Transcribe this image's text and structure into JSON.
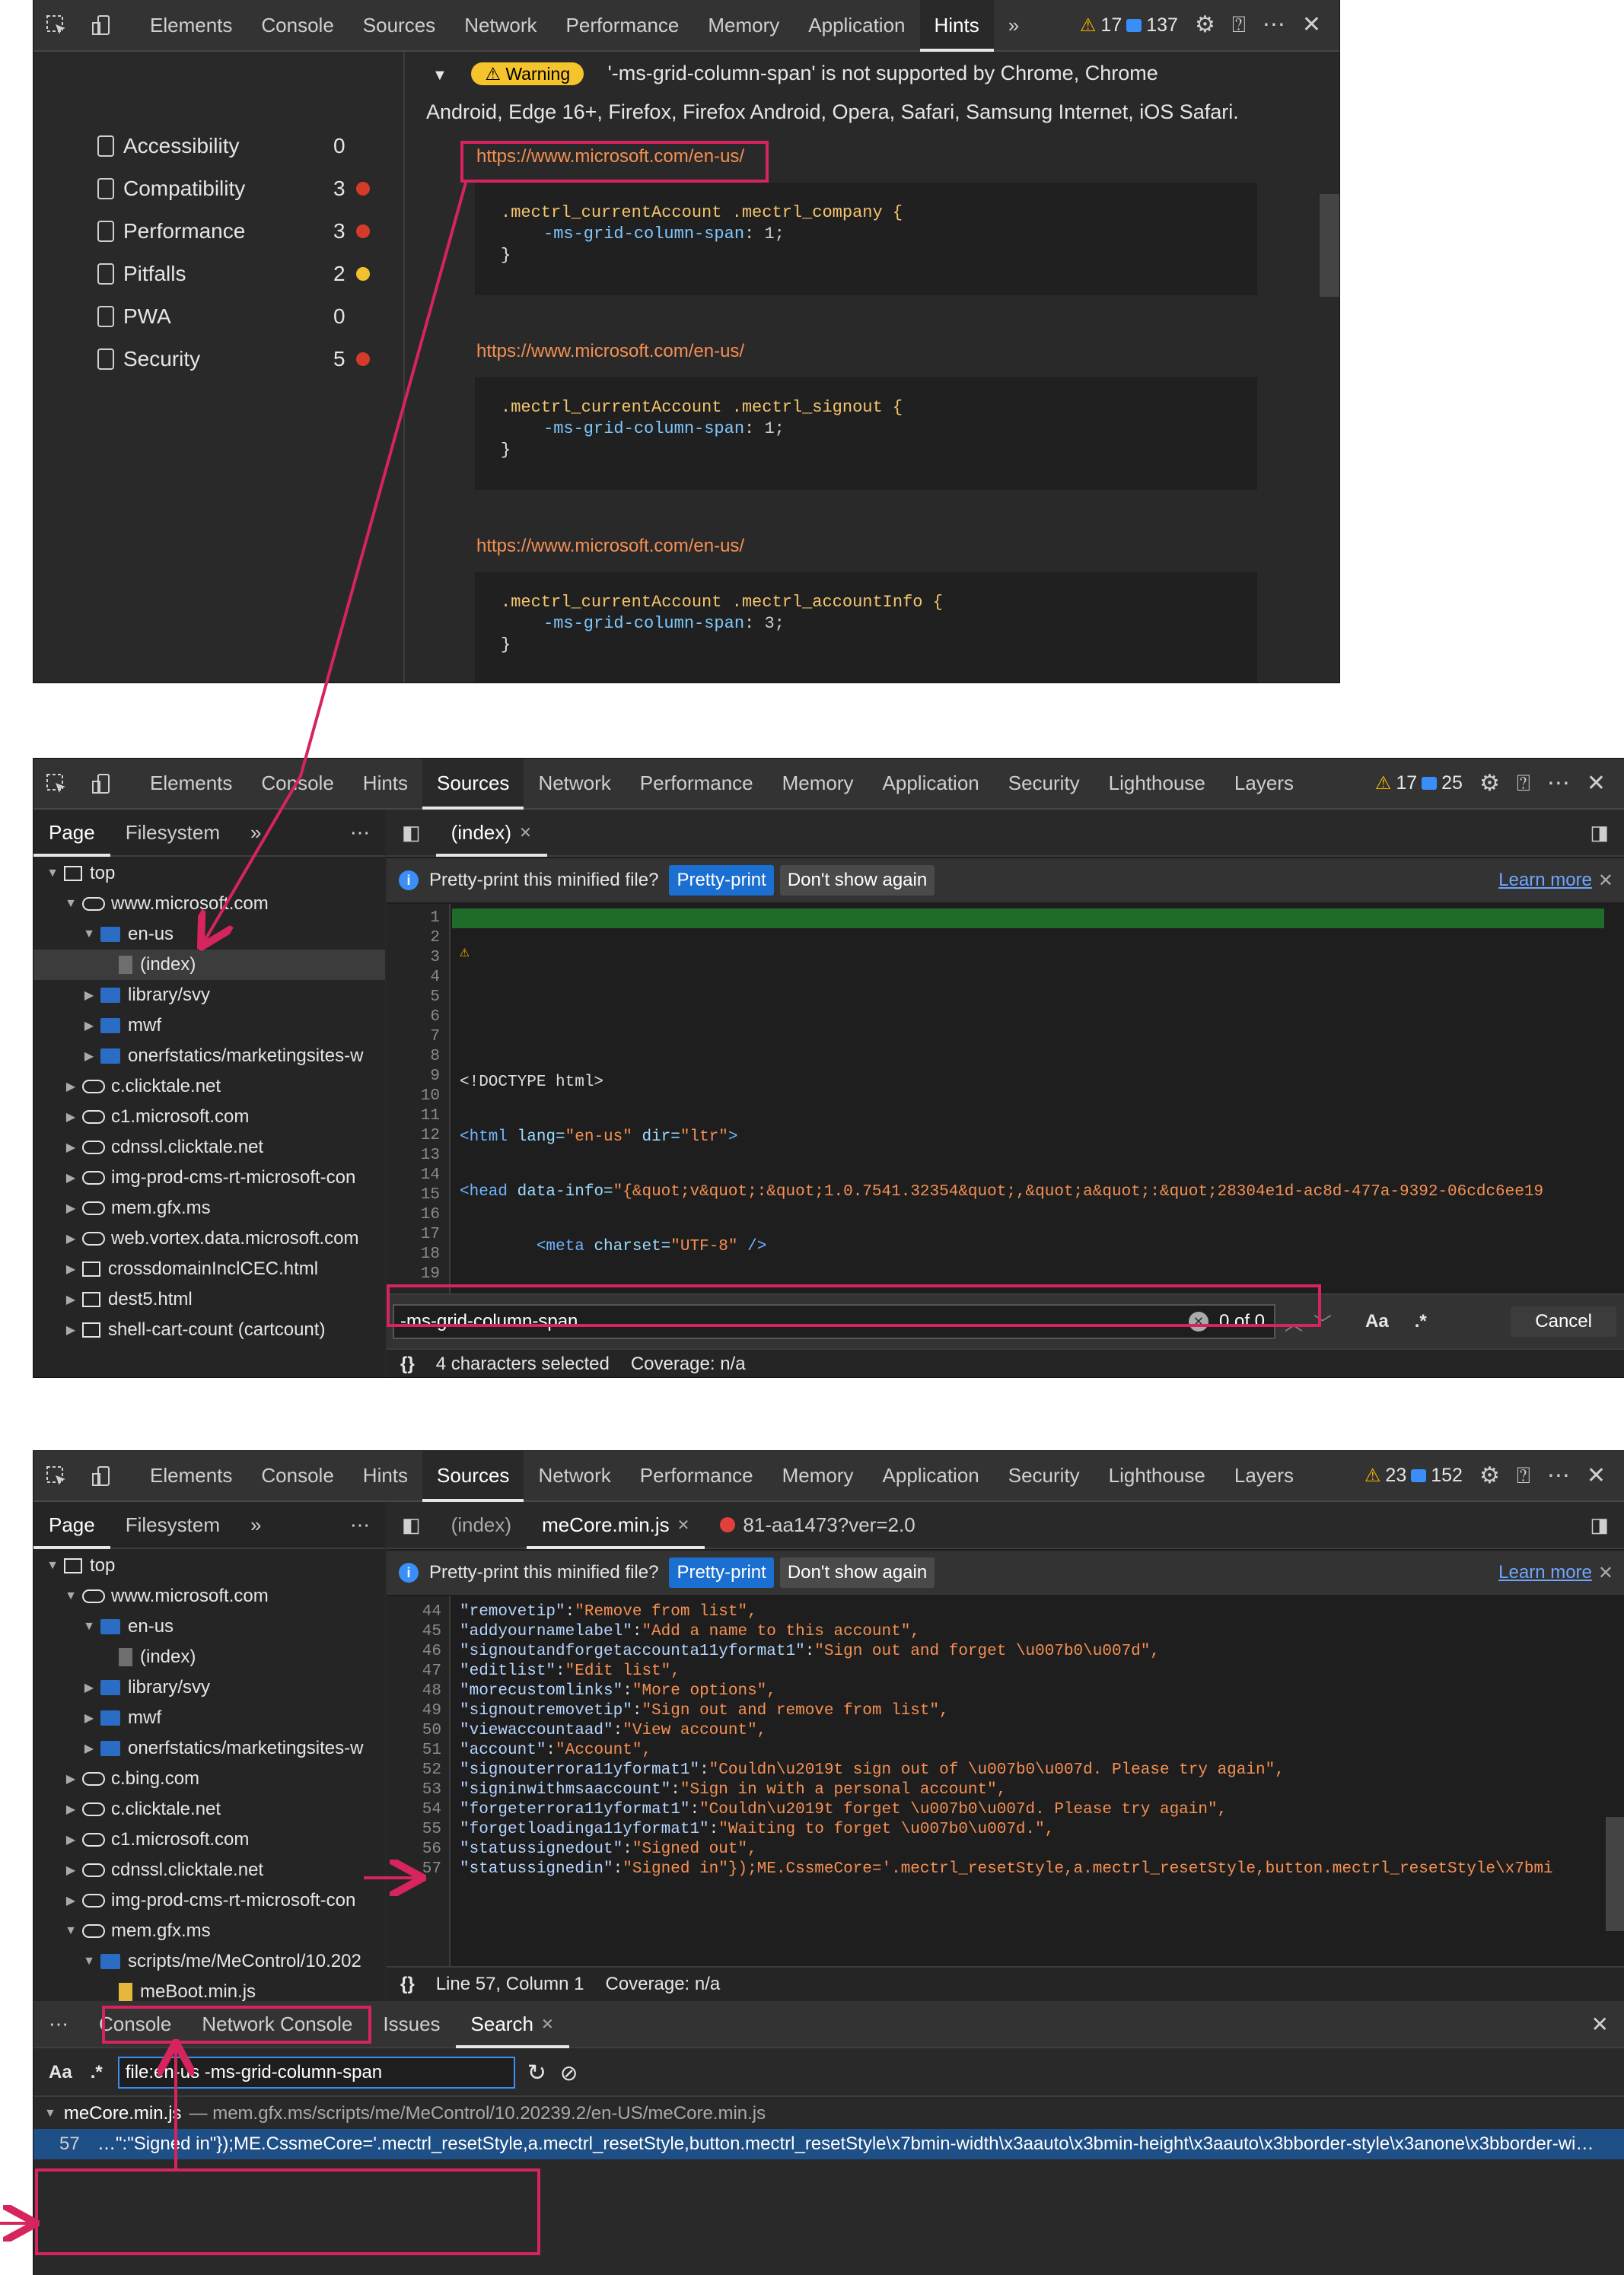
{
  "panel1": {
    "tabs": [
      "Elements",
      "Console",
      "Sources",
      "Network",
      "Performance",
      "Memory",
      "Application",
      "Hints"
    ],
    "active_tab": "Hints",
    "more": "»",
    "warnings": "17",
    "messages": "137",
    "categories": [
      {
        "name": "Accessibility",
        "count": "0",
        "dot": ""
      },
      {
        "name": "Compatibility",
        "count": "3",
        "dot": "#d63b2a"
      },
      {
        "name": "Performance",
        "count": "3",
        "dot": "#d63b2a"
      },
      {
        "name": "Pitfalls",
        "count": "2",
        "dot": "#f2c12e"
      },
      {
        "name": "PWA",
        "count": "0",
        "dot": ""
      },
      {
        "name": "Security",
        "count": "5",
        "dot": "#d63b2a"
      }
    ],
    "warning_label": "Warning",
    "warning_text_1": "'-ms-grid-column-span' is not supported by Chrome, Chrome",
    "warning_text_2": "Android, Edge 16+, Firefox, Firefox Android, Opera, Safari, Samsung Internet, iOS Safari.",
    "hints": [
      {
        "url": "https://www.microsoft.com/en-us/",
        "selector": ".mectrl_currentAccount .mectrl_company {",
        "property": "-ms-grid-column-span",
        "value": "1;"
      },
      {
        "url": "https://www.microsoft.com/en-us/",
        "selector": ".mectrl_currentAccount .mectrl_signout {",
        "property": "-ms-grid-column-span",
        "value": "1;"
      },
      {
        "url": "https://www.microsoft.com/en-us/",
        "selector": ".mectrl_currentAccount .mectrl_accountInfo {",
        "property": "-ms-grid-column-span",
        "value": "3;"
      }
    ]
  },
  "panel2": {
    "tabs": [
      "Elements",
      "Console",
      "Hints",
      "Sources",
      "Network",
      "Performance",
      "Memory",
      "Application",
      "Security",
      "Lighthouse",
      "Layers"
    ],
    "active_tab": "Sources",
    "warnings": "17",
    "messages": "25",
    "nav_tabs": [
      "Page",
      "Filesystem"
    ],
    "file_tab": "(index)",
    "tree": [
      {
        "label": "top",
        "type": "frame",
        "indent": 0,
        "arrow": "▼"
      },
      {
        "label": "www.microsoft.com",
        "type": "cloud",
        "indent": 1,
        "arrow": "▼"
      },
      {
        "label": "en-us",
        "type": "folder",
        "indent": 2,
        "arrow": "▼"
      },
      {
        "label": "(index)",
        "type": "file",
        "indent": 3,
        "arrow": "",
        "selected": true
      },
      {
        "label": "library/svy",
        "type": "folder",
        "indent": 2,
        "arrow": "▶"
      },
      {
        "label": "mwf",
        "type": "folder",
        "indent": 2,
        "arrow": "▶"
      },
      {
        "label": "onerfstatics/marketingsites-w",
        "type": "folder",
        "indent": 2,
        "arrow": "▶"
      },
      {
        "label": "c.clicktale.net",
        "type": "cloud",
        "indent": 1,
        "arrow": "▶"
      },
      {
        "label": "c1.microsoft.com",
        "type": "cloud",
        "indent": 1,
        "arrow": "▶"
      },
      {
        "label": "cdnssl.clicktale.net",
        "type": "cloud",
        "indent": 1,
        "arrow": "▶"
      },
      {
        "label": "img-prod-cms-rt-microsoft-con",
        "type": "cloud",
        "indent": 1,
        "arrow": "▶"
      },
      {
        "label": "mem.gfx.ms",
        "type": "cloud",
        "indent": 1,
        "arrow": "▶"
      },
      {
        "label": "web.vortex.data.microsoft.com",
        "type": "cloud",
        "indent": 1,
        "arrow": "▶"
      },
      {
        "label": "crossdomainInclCEC.html",
        "type": "frame",
        "indent": 1,
        "arrow": "▶"
      },
      {
        "label": "dest5.html",
        "type": "frame",
        "indent": 1,
        "arrow": "▶"
      },
      {
        "label": "shell-cart-count (cartcount)",
        "type": "frame",
        "indent": 1,
        "arrow": "▶"
      }
    ],
    "info_text": "Pretty-print this minified file?",
    "pretty_print": "Pretty-print",
    "dont_show": "Don't show again",
    "learn_more": "Learn more",
    "line_numbers": [
      "1",
      "2",
      "3",
      "4",
      "5",
      "6",
      "7",
      "8",
      "9",
      "10",
      "11",
      "12",
      "13",
      "14",
      "15",
      "16",
      "17",
      "18",
      "19"
    ],
    "search_value": "-ms-grid-column-span",
    "search_count": "0 of 0",
    "match_case": "Aa",
    "regex": ".*",
    "cancel": "Cancel",
    "status_braces": "{}",
    "status_selected": "4 characters selected",
    "status_coverage": "Coverage: n/a"
  },
  "panel3": {
    "tabs": [
      "Elements",
      "Console",
      "Hints",
      "Sources",
      "Network",
      "Performance",
      "Memory",
      "Application",
      "Security",
      "Lighthouse",
      "Layers"
    ],
    "active_tab": "Sources",
    "warnings": "23",
    "messages": "152",
    "nav_tabs": [
      "Page",
      "Filesystem"
    ],
    "file_tabs": [
      "(index)",
      "meCore.min.js",
      "81-aa1473?ver=2.0"
    ],
    "tree": [
      {
        "label": "top",
        "type": "frame",
        "indent": 0,
        "arrow": "▼"
      },
      {
        "label": "www.microsoft.com",
        "type": "cloud",
        "indent": 1,
        "arrow": "▼"
      },
      {
        "label": "en-us",
        "type": "folder",
        "indent": 2,
        "arrow": "▼"
      },
      {
        "label": "(index)",
        "type": "file",
        "indent": 3,
        "arrow": ""
      },
      {
        "label": "library/svy",
        "type": "folder",
        "indent": 2,
        "arrow": "▶"
      },
      {
        "label": "mwf",
        "type": "folder",
        "indent": 2,
        "arrow": "▶"
      },
      {
        "label": "onerfstatics/marketingsites-w",
        "type": "folder",
        "indent": 2,
        "arrow": "▶"
      },
      {
        "label": "c.bing.com",
        "type": "cloud",
        "indent": 1,
        "arrow": "▶"
      },
      {
        "label": "c.clicktale.net",
        "type": "cloud",
        "indent": 1,
        "arrow": "▶"
      },
      {
        "label": "c1.microsoft.com",
        "type": "cloud",
        "indent": 1,
        "arrow": "▶"
      },
      {
        "label": "cdnssl.clicktale.net",
        "type": "cloud",
        "indent": 1,
        "arrow": "▶"
      },
      {
        "label": "img-prod-cms-rt-microsoft-con",
        "type": "cloud",
        "indent": 1,
        "arrow": "▶"
      },
      {
        "label": "mem.gfx.ms",
        "type": "cloud",
        "indent": 1,
        "arrow": "▼"
      },
      {
        "label": "scripts/me/MeControl/10.202",
        "type": "folder",
        "indent": 2,
        "arrow": "▼"
      },
      {
        "label": "meBoot.min.js",
        "type": "jsfile",
        "indent": 3,
        "arrow": ""
      },
      {
        "label": "meCore.min.js",
        "type": "jsfile",
        "indent": 3,
        "arrow": "",
        "selected": true
      }
    ],
    "info_text": "Pretty-print this minified file?",
    "pretty_print": "Pretty-print",
    "dont_show": "Don't show again",
    "learn_more": "Learn more",
    "code_lines": [
      {
        "n": "44",
        "k": "\"removetip\"",
        "v": "\"Remove from list\","
      },
      {
        "n": "45",
        "k": "\"addyournamelabel\"",
        "v": "\"Add a name to this account\","
      },
      {
        "n": "46",
        "k": "\"signoutandforgetaccounta11yformat1\"",
        "v": "\"Sign out and forget \\u007b0\\u007d\","
      },
      {
        "n": "47",
        "k": "\"editlist\"",
        "v": "\"Edit list\","
      },
      {
        "n": "48",
        "k": "\"morecustomlinks\"",
        "v": "\"More options\","
      },
      {
        "n": "49",
        "k": "\"signoutremovetip\"",
        "v": "\"Sign out and remove from list\","
      },
      {
        "n": "50",
        "k": "\"viewaccountaad\"",
        "v": "\"View account\","
      },
      {
        "n": "51",
        "k": "\"account\"",
        "v": "\"Account\","
      },
      {
        "n": "52",
        "k": "\"signouterrora11yformat1\"",
        "v": "\"Couldn\\u2019t sign out of \\u007b0\\u007d. Please try again\","
      },
      {
        "n": "53",
        "k": "\"signinwithmsaaccount\"",
        "v": "\"Sign in with a personal account\","
      },
      {
        "n": "54",
        "k": "\"forgeterrora11yformat1\"",
        "v": "\"Couldn\\u2019t forget \\u007b0\\u007d. Please try again\","
      },
      {
        "n": "55",
        "k": "\"forgetloadinga11yformat1\"",
        "v": "\"Waiting to forget \\u007b0\\u007d.\","
      },
      {
        "n": "56",
        "k": "\"statussignedout\"",
        "v": "\"Signed out\","
      },
      {
        "n": "57",
        "k": "\"statussignedin\"",
        "v": "\"Signed in\"});ME.CssmeCore='.mectrl_resetStyle,a.mectrl_resetStyle,button.mectrl_resetStyle\\x7bmi"
      }
    ],
    "status_braces": "{}",
    "status_position": "Line 57, Column 1",
    "status_coverage": "Coverage: n/a",
    "drawer_tabs": [
      "Console",
      "Network Console",
      "Issues",
      "Search"
    ],
    "drawer_active": "Search",
    "search_query": "file:en-us -ms-grid-column-span",
    "match_case": "Aa",
    "regex": ".*",
    "result_file": "meCore.min.js",
    "result_path": "— mem.gfx.ms/scripts/me/MeControl/10.20239.2/en-US/meCore.min.js",
    "result_line": "57",
    "result_text": "…\":\"Signed in\"});ME.CssmeCore='.mectrl_resetStyle,a.mectrl_resetStyle,button.mectrl_resetStyle\\x7bmin-width\\x3aauto\\x3bmin-height\\x3aauto\\x3bborder-style\\x3anone\\x3bborder-wi…"
  },
  "colors": {
    "annotation": "#d6245c",
    "accent_blue": "#1a6fd1",
    "warning_yellow": "#f5b400"
  }
}
